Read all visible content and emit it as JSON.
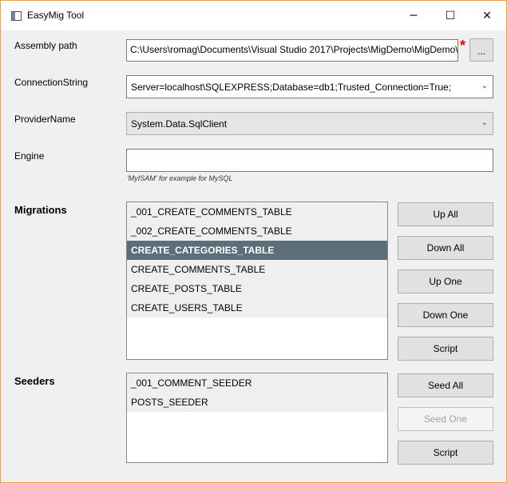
{
  "window": {
    "title": "EasyMig Tool"
  },
  "assembly": {
    "label": "Assembly path",
    "value": "C:\\Users\\romag\\Documents\\Visual Studio 2017\\Projects\\MigDemo\\MigDemo\\",
    "required_marker": "*",
    "browse_label": "..."
  },
  "connection": {
    "label": "ConnectionString",
    "value": "Server=localhost\\SQLEXPRESS;Database=db1;Trusted_Connection=True;"
  },
  "provider": {
    "label": "ProviderName",
    "value": "System.Data.SqlClient"
  },
  "engine": {
    "label": "Engine",
    "value": "",
    "hint": "'MyISAM' for example for MySQL"
  },
  "migrations": {
    "label": "Migrations",
    "items": [
      "_001_CREATE_COMMENTS_TABLE",
      "_002_CREATE_COMMENTS_TABLE",
      "CREATE_CATEGORIES_TABLE",
      "CREATE_COMMENTS_TABLE",
      "CREATE_POSTS_TABLE",
      "CREATE_USERS_TABLE"
    ],
    "selected_index": 2,
    "buttons": {
      "up_all": "Up All",
      "down_all": "Down All",
      "up_one": "Up One",
      "down_one": "Down One",
      "script": "Script"
    }
  },
  "seeders": {
    "label": "Seeders",
    "items": [
      "_001_COMMENT_SEEDER",
      "POSTS_SEEDER"
    ],
    "buttons": {
      "seed_all": "Seed All",
      "seed_one": "Seed One",
      "script": "Script"
    }
  },
  "colors": {
    "accent_border": "#e8a24a",
    "selected_bg": "#5b6e79",
    "required": "#e00000"
  }
}
